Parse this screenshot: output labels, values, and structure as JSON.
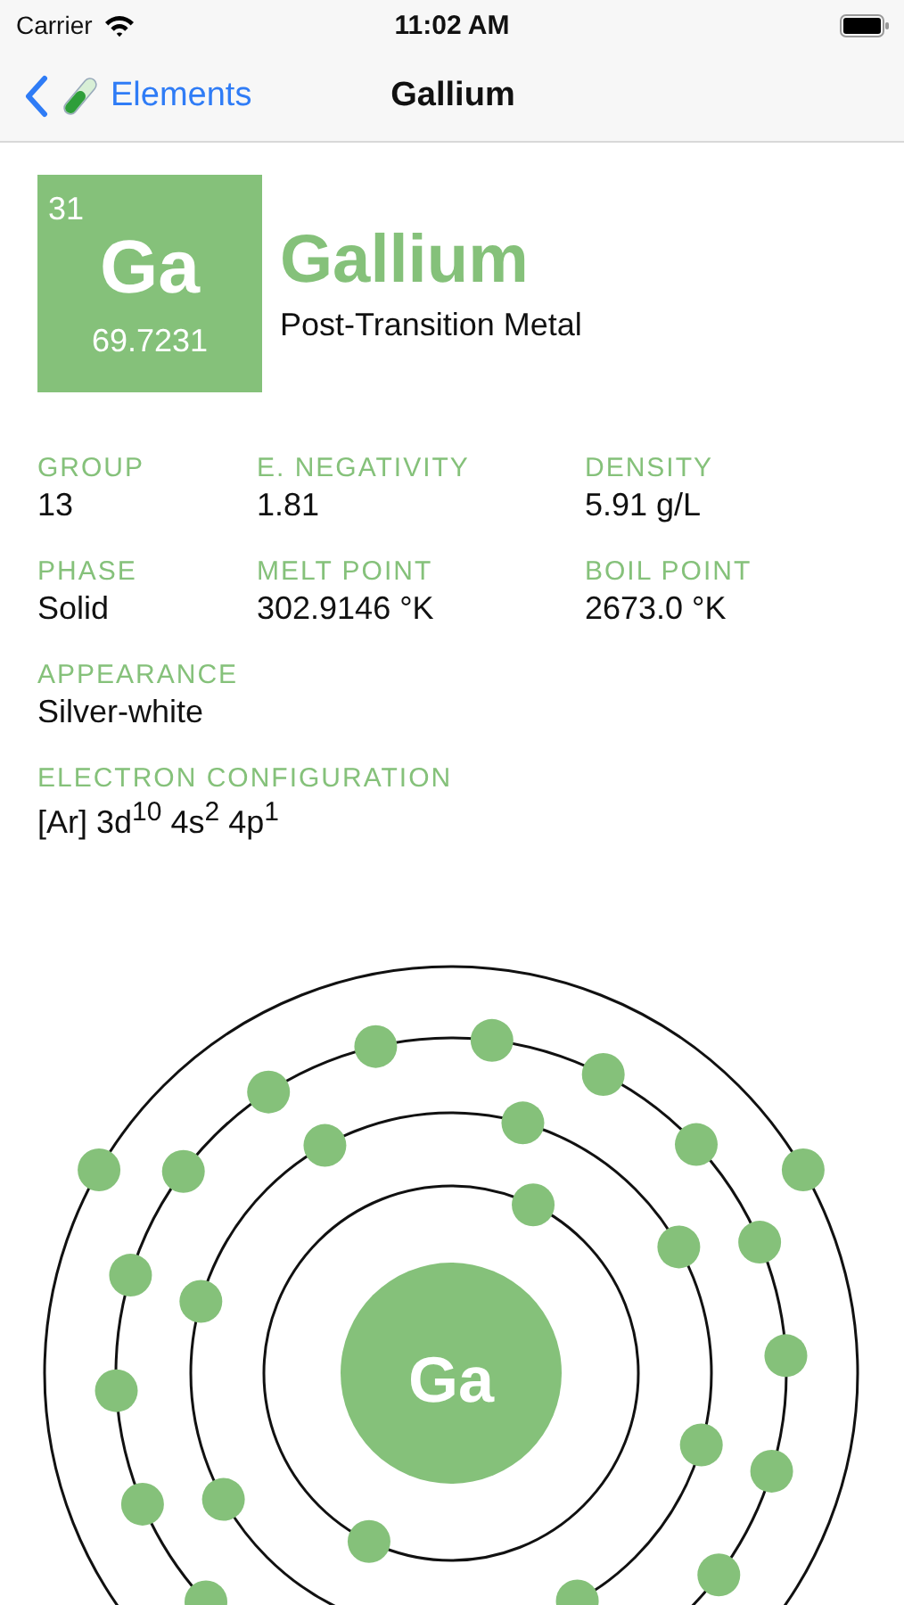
{
  "status_bar": {
    "carrier": "Carrier",
    "time": "11:02 AM"
  },
  "nav": {
    "back_label": "Elements",
    "title": "Gallium"
  },
  "element": {
    "number": "31",
    "symbol": "Ga",
    "mass": "69.7231",
    "name": "Gallium",
    "category": "Post-Transition Metal"
  },
  "properties": [
    {
      "label": "GROUP",
      "value": "13"
    },
    {
      "label": "E. NEGATIVITY",
      "value": "1.81"
    },
    {
      "label": "DENSITY",
      "value": "5.91 g/L"
    },
    {
      "label": "PHASE",
      "value": "Solid"
    },
    {
      "label": "MELT POINT",
      "value": "302.9146 °K"
    },
    {
      "label": "BOIL POINT",
      "value": "2673.0 °K"
    }
  ],
  "appearance": {
    "label": "APPEARANCE",
    "value": "Silver-white"
  },
  "electron_configuration": {
    "label": "ELECTRON CONFIGURATION",
    "value": "[Ar] 3d$^{10}$ 4s$^{2}$ 4p$^{1}$"
  },
  "atom_model": {
    "symbol": "Ga"
  }
}
